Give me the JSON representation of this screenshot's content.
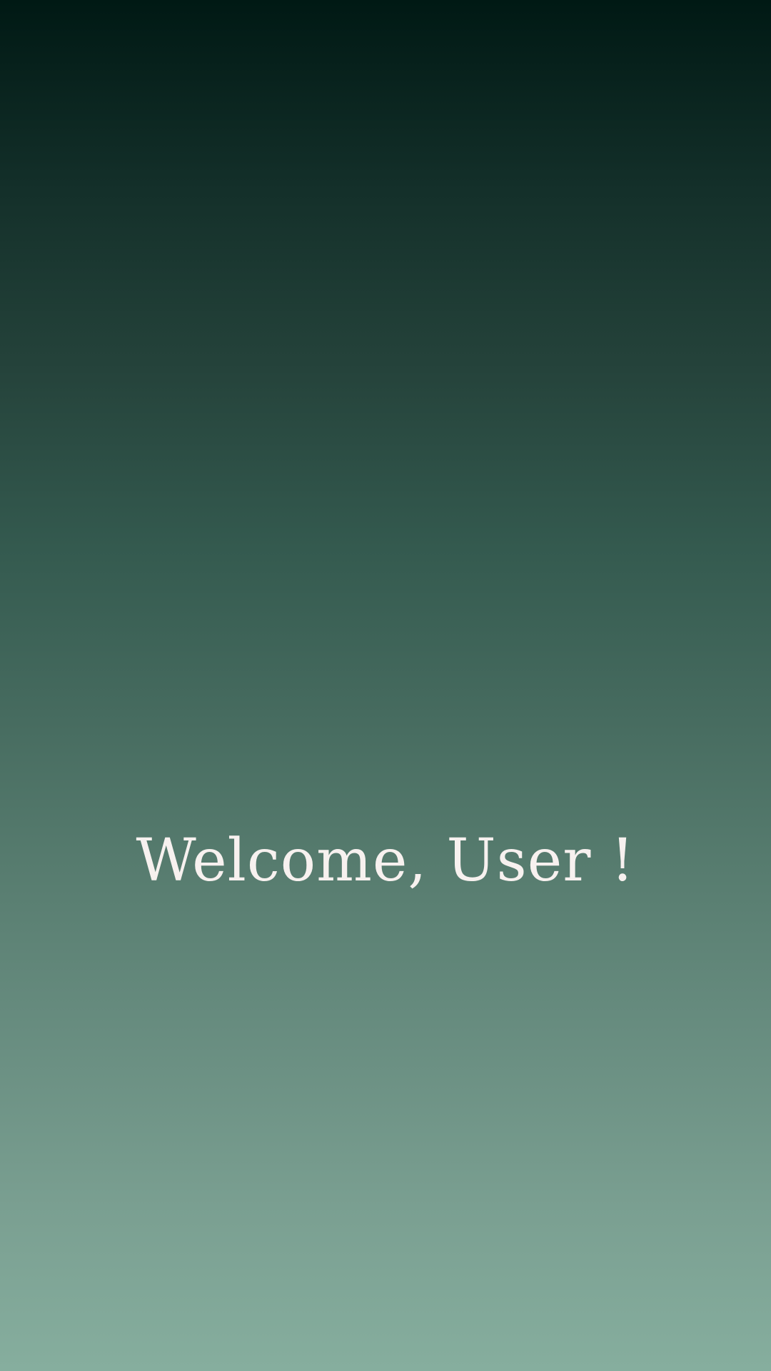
{
  "welcome": {
    "message": "Welcome, User !"
  },
  "colors": {
    "gradient_top": "#001914",
    "gradient_bottom": "#86ae9e",
    "text": "#f7f1ef"
  }
}
